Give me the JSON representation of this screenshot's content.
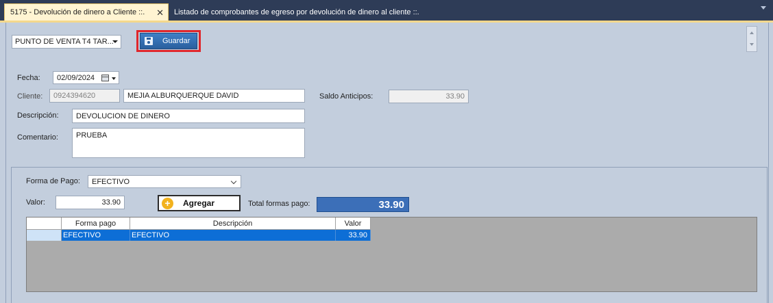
{
  "tabs": {
    "active_label": "5175 - Devolución de dinero a Cliente ::.",
    "close_glyph": "✕",
    "inactive_label": "Listado de comprobantes de egreso por devolución de dinero al cliente ::."
  },
  "toolbar": {
    "punto_venta_value": "PUNTO DE VENTA T4 TAR...",
    "save_label": "Guardar"
  },
  "form": {
    "fecha_label": "Fecha:",
    "fecha_value": "02/09/2024",
    "cliente_label": "Cliente:",
    "cliente_id": "0924394620",
    "cliente_nombre": "MEJIA ALBURQUERQUE DAVID",
    "saldo_label": "Saldo Anticipos:",
    "saldo_value": "33.90",
    "descripcion_label": "Descripción:",
    "descripcion_value": "DEVOLUCION DE DINERO",
    "comentario_label": "Comentario:",
    "comentario_value": "PRUEBA"
  },
  "pago": {
    "forma_label": "Forma de Pago:",
    "forma_value": "EFECTIVO",
    "valor_label": "Valor:",
    "valor_value": "33.90",
    "agregar_label": "Agregar",
    "agregar_glyph": "+",
    "total_label": "Total formas pago:",
    "total_value": "33.90"
  },
  "grid": {
    "columns": [
      "Forma pago",
      "Descripción",
      "Valor"
    ],
    "rows": [
      {
        "forma_pago": "EFECTIVO",
        "descripcion": "EFECTIVO",
        "valor": "33.90"
      }
    ]
  },
  "colors": {
    "tabbar_bg": "#2e3c57",
    "active_tab_bg": "#fff4d2",
    "save_button": "#3f80c7",
    "highlight_border": "#e0262b",
    "total_box": "#3c6fb8",
    "grid_selected_row": "#0d6ed6"
  },
  "icons": {
    "save": "floppy-disk-icon",
    "add": "plus-circle-icon",
    "calendar": "calendar-icon"
  }
}
